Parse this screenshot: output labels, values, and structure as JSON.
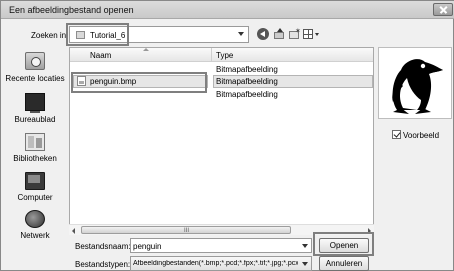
{
  "window": {
    "title": "Een afbeeldingbestand openen"
  },
  "toolbar": {
    "look_in_label": "Zoeken in:",
    "look_in_value": "Tutorial_6",
    "icons": [
      "back-icon",
      "up-folder-icon",
      "new-folder-icon",
      "views-menu-icon"
    ]
  },
  "places": [
    {
      "label": "Recente locaties",
      "icon": "recent-places-icon"
    },
    {
      "label": "Bureaublad",
      "icon": "desktop-icon"
    },
    {
      "label": "Bibliotheken",
      "icon": "libraries-icon"
    },
    {
      "label": "Computer",
      "icon": "computer-icon"
    },
    {
      "label": "Netwerk",
      "icon": "network-icon"
    }
  ],
  "file_list": {
    "columns": [
      "Naam",
      "Type"
    ],
    "rows": [
      {
        "name": "",
        "type": "Bitmapafbeelding"
      },
      {
        "name": "penguin.bmp",
        "type": "Bitmapafbeelding",
        "selected": true
      },
      {
        "name": "",
        "type": "Bitmapafbeelding"
      }
    ],
    "scroll_grip": "III"
  },
  "preview": {
    "label": "Voorbeeld",
    "checked": true,
    "image": "penguin-image"
  },
  "filename": {
    "label": "Bestandsnaam:",
    "value": "penguin"
  },
  "filetype": {
    "label": "Bestandstypen:",
    "value": "Afbeeldingbestanden(*.bmp;*.pcd;*.fpx;*.tif;*.jpg;*.pcx"
  },
  "buttons": {
    "open": "Openen",
    "cancel": "Annuleren"
  },
  "colors": {
    "highlight_border": "#7f7f7f",
    "selection": "#e6e6e6",
    "dialog_bg": "#f0f0f0"
  }
}
